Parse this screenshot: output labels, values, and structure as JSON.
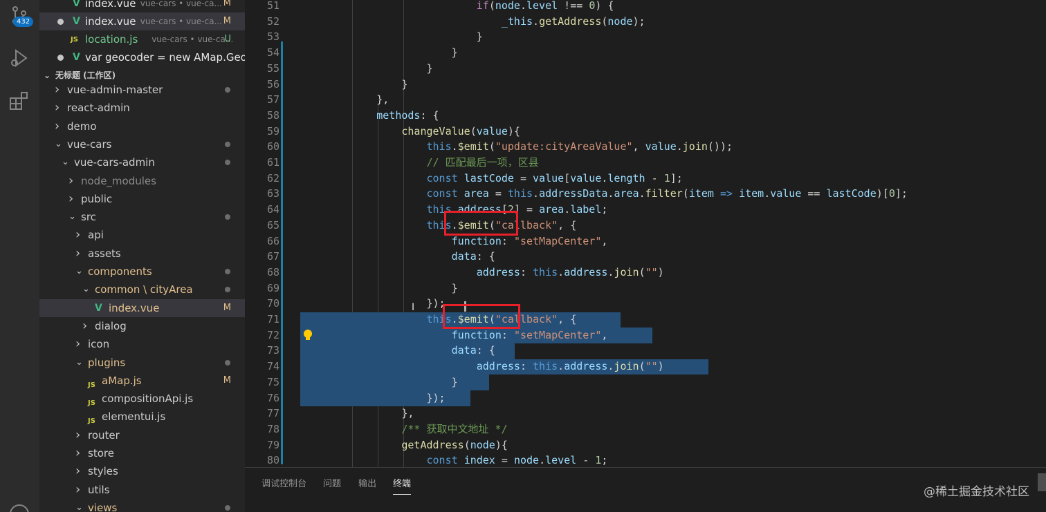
{
  "activity_bar": {
    "scm_badge": "432",
    "icons": [
      "source-control-icon",
      "run-debug-icon",
      "extensions-icon",
      "account-icon"
    ]
  },
  "open_editors": [
    {
      "name": "index.vue",
      "desc": "vue-cars • vue-ca...",
      "status": "M",
      "icon": "vue",
      "active": false
    },
    {
      "name": "index.vue",
      "desc": "vue-cars • vue-ca...",
      "status": "M",
      "icon": "vue",
      "active": true
    },
    {
      "name": "location.js",
      "desc": "vue-cars • vue-ca...",
      "status": "U",
      "icon": "js",
      "active": false
    },
    {
      "name": "var geocoder = new AMap.Geo...",
      "desc": "",
      "status": "",
      "icon": "vue",
      "active": false
    }
  ],
  "workspace": {
    "title": "无标题 (工作区)",
    "tree": [
      {
        "label": "vue-admin-master",
        "depth": 0,
        "chev": ">",
        "dot": true
      },
      {
        "label": "react-admin",
        "depth": 0,
        "chev": ">",
        "dot": false
      },
      {
        "label": "demo",
        "depth": 0,
        "chev": ">",
        "dot": false
      },
      {
        "label": "vue-cars",
        "depth": 0,
        "chev": "v",
        "dot": true
      },
      {
        "label": "vue-cars-admin",
        "depth": 1,
        "chev": "v",
        "dot": true
      },
      {
        "label": "node_modules",
        "depth": 2,
        "chev": ">",
        "dot": false,
        "dim": true
      },
      {
        "label": "public",
        "depth": 2,
        "chev": ">",
        "dot": false
      },
      {
        "label": "src",
        "depth": 2,
        "chev": "v",
        "dot": true
      },
      {
        "label": "api",
        "depth": 3,
        "chev": ">",
        "dot": false
      },
      {
        "label": "assets",
        "depth": 3,
        "chev": ">",
        "dot": false
      },
      {
        "label": "components",
        "depth": 3,
        "chev": "v",
        "dot": true,
        "mod": true
      },
      {
        "label": "common \\ cityArea",
        "depth": 4,
        "chev": "v",
        "dot": true,
        "mod": true
      },
      {
        "label": "index.vue",
        "depth": 5,
        "chev": "",
        "icon": "vue",
        "letter": "M",
        "mod": true,
        "selected": true
      },
      {
        "label": "dialog",
        "depth": 4,
        "chev": ">",
        "dot": false
      },
      {
        "label": "icon",
        "depth": 3,
        "chev": ">",
        "dot": false
      },
      {
        "label": "plugins",
        "depth": 3,
        "chev": "v",
        "dot": true,
        "mod": true
      },
      {
        "label": "aMap.js",
        "depth": 4,
        "chev": "",
        "icon": "js",
        "letter": "M",
        "mod": true
      },
      {
        "label": "compositionApi.js",
        "depth": 4,
        "chev": "",
        "icon": "js"
      },
      {
        "label": "elementui.js",
        "depth": 4,
        "chev": "",
        "icon": "js"
      },
      {
        "label": "router",
        "depth": 3,
        "chev": ">",
        "dot": false
      },
      {
        "label": "store",
        "depth": 3,
        "chev": ">",
        "dot": false
      },
      {
        "label": "styles",
        "depth": 3,
        "chev": ">",
        "dot": false
      },
      {
        "label": "utils",
        "depth": 3,
        "chev": ">",
        "dot": false
      },
      {
        "label": "views",
        "depth": 3,
        "chev": "v",
        "dot": true,
        "mod": true
      }
    ]
  },
  "editor": {
    "lines": [
      {
        "n": "51",
        "tokens": [
          [
            "p",
            "                        "
          ],
          [
            "kc",
            "if"
          ],
          [
            "p",
            "("
          ],
          [
            "v",
            "node"
          ],
          [
            "p",
            "."
          ],
          [
            "v",
            "level"
          ],
          [
            "p",
            " !== "
          ],
          [
            "n",
            "0"
          ],
          [
            "p",
            ") {"
          ]
        ]
      },
      {
        "n": "52",
        "tokens": [
          [
            "p",
            "                            "
          ],
          [
            "v",
            "_this"
          ],
          [
            "p",
            "."
          ],
          [
            "f",
            "getAddress"
          ],
          [
            "p",
            "("
          ],
          [
            "v",
            "node"
          ],
          [
            "p",
            ");"
          ]
        ]
      },
      {
        "n": "53",
        "tokens": [
          [
            "p",
            "                        }"
          ]
        ]
      },
      {
        "n": "54",
        "tokens": [
          [
            "p",
            "                    }"
          ]
        ]
      },
      {
        "n": "55",
        "tokens": [
          [
            "p",
            "                }"
          ]
        ]
      },
      {
        "n": "56",
        "tokens": [
          [
            "p",
            "            }"
          ]
        ]
      },
      {
        "n": "57",
        "tokens": [
          [
            "p",
            "        },"
          ]
        ]
      },
      {
        "n": "58",
        "tokens": [
          [
            "p",
            "        "
          ],
          [
            "v",
            "methods"
          ],
          [
            "p",
            ": {"
          ]
        ]
      },
      {
        "n": "59",
        "tokens": [
          [
            "p",
            "            "
          ],
          [
            "f",
            "changeValue"
          ],
          [
            "p",
            "("
          ],
          [
            "v",
            "value"
          ],
          [
            "p",
            "){"
          ]
        ]
      },
      {
        "n": "60",
        "tokens": [
          [
            "p",
            "                "
          ],
          [
            "k",
            "this"
          ],
          [
            "p",
            "."
          ],
          [
            "f",
            "$emit"
          ],
          [
            "p",
            "("
          ],
          [
            "s",
            "\"update:cityAreaValue\""
          ],
          [
            "p",
            ", "
          ],
          [
            "v",
            "value"
          ],
          [
            "p",
            "."
          ],
          [
            "f",
            "join"
          ],
          [
            "p",
            "());"
          ]
        ]
      },
      {
        "n": "61",
        "tokens": [
          [
            "p",
            "                "
          ],
          [
            "c",
            "// 匹配最后一项，区县"
          ]
        ]
      },
      {
        "n": "62",
        "tokens": [
          [
            "p",
            "                "
          ],
          [
            "k",
            "const"
          ],
          [
            "p",
            " "
          ],
          [
            "v",
            "lastCode"
          ],
          [
            "p",
            " = "
          ],
          [
            "v",
            "value"
          ],
          [
            "p",
            "["
          ],
          [
            "v",
            "value"
          ],
          [
            "p",
            "."
          ],
          [
            "v",
            "length"
          ],
          [
            "p",
            " - "
          ],
          [
            "n",
            "1"
          ],
          [
            "p",
            "];"
          ]
        ]
      },
      {
        "n": "63",
        "tokens": [
          [
            "p",
            "                "
          ],
          [
            "k",
            "const"
          ],
          [
            "p",
            " "
          ],
          [
            "v",
            "area"
          ],
          [
            "p",
            " = "
          ],
          [
            "k",
            "this"
          ],
          [
            "p",
            "."
          ],
          [
            "v",
            "addressData"
          ],
          [
            "p",
            "."
          ],
          [
            "v",
            "area"
          ],
          [
            "p",
            "."
          ],
          [
            "f",
            "filter"
          ],
          [
            "p",
            "("
          ],
          [
            "v",
            "item"
          ],
          [
            "p",
            " "
          ],
          [
            "k",
            "=>"
          ],
          [
            "p",
            " "
          ],
          [
            "v",
            "item"
          ],
          [
            "p",
            "."
          ],
          [
            "v",
            "value"
          ],
          [
            "p",
            " == "
          ],
          [
            "v",
            "lastCode"
          ],
          [
            "p",
            ")["
          ],
          [
            "n",
            "0"
          ],
          [
            "p",
            "];"
          ]
        ]
      },
      {
        "n": "64",
        "tokens": [
          [
            "p",
            "                "
          ],
          [
            "k",
            "this"
          ],
          [
            "p",
            "."
          ],
          [
            "v",
            "address"
          ],
          [
            "p",
            "["
          ],
          [
            "n",
            "2"
          ],
          [
            "p",
            "] = "
          ],
          [
            "v",
            "area"
          ],
          [
            "p",
            "."
          ],
          [
            "v",
            "label"
          ],
          [
            "p",
            ";"
          ]
        ]
      },
      {
        "n": "65",
        "tokens": [
          [
            "p",
            "                "
          ],
          [
            "k",
            "this"
          ],
          [
            "p",
            "."
          ],
          [
            "f",
            "$emit"
          ],
          [
            "p",
            "("
          ],
          [
            "s",
            "\"callback\""
          ],
          [
            "p",
            ", {"
          ]
        ]
      },
      {
        "n": "66",
        "tokens": [
          [
            "p",
            "                    "
          ],
          [
            "v",
            "function"
          ],
          [
            "p",
            ": "
          ],
          [
            "s",
            "\"setMapCenter\""
          ],
          [
            "p",
            ","
          ]
        ]
      },
      {
        "n": "67",
        "tokens": [
          [
            "p",
            "                    "
          ],
          [
            "v",
            "data"
          ],
          [
            "p",
            ": {"
          ]
        ]
      },
      {
        "n": "68",
        "tokens": [
          [
            "p",
            "                        "
          ],
          [
            "v",
            "address"
          ],
          [
            "p",
            ": "
          ],
          [
            "k",
            "this"
          ],
          [
            "p",
            "."
          ],
          [
            "v",
            "address"
          ],
          [
            "p",
            "."
          ],
          [
            "f",
            "join"
          ],
          [
            "p",
            "("
          ],
          [
            "s",
            "\"\""
          ],
          [
            "p",
            ")"
          ]
        ]
      },
      {
        "n": "69",
        "tokens": [
          [
            "p",
            "                    }"
          ]
        ]
      },
      {
        "n": "70",
        "tokens": [
          [
            "p",
            "                });"
          ]
        ]
      },
      {
        "n": "71",
        "tokens": [
          [
            "p",
            "                "
          ],
          [
            "k",
            "this"
          ],
          [
            "p",
            "."
          ],
          [
            "f",
            "$emit"
          ],
          [
            "p",
            "("
          ],
          [
            "s",
            "\"callback\""
          ],
          [
            "p",
            ", {"
          ]
        ]
      },
      {
        "n": "72",
        "tokens": [
          [
            "p",
            "                    "
          ],
          [
            "v",
            "function"
          ],
          [
            "p",
            ": "
          ],
          [
            "s",
            "\"setMapCenter\""
          ],
          [
            "p",
            ","
          ]
        ]
      },
      {
        "n": "73",
        "tokens": [
          [
            "p",
            "                    "
          ],
          [
            "v",
            "data"
          ],
          [
            "p",
            ": {"
          ]
        ]
      },
      {
        "n": "74",
        "tokens": [
          [
            "p",
            "                        "
          ],
          [
            "v",
            "address"
          ],
          [
            "p",
            ": "
          ],
          [
            "k",
            "this"
          ],
          [
            "p",
            "."
          ],
          [
            "v",
            "address"
          ],
          [
            "p",
            "."
          ],
          [
            "f",
            "join"
          ],
          [
            "p",
            "("
          ],
          [
            "s",
            "\"\""
          ],
          [
            "p",
            ")"
          ]
        ]
      },
      {
        "n": "75",
        "tokens": [
          [
            "p",
            "                    }"
          ]
        ]
      },
      {
        "n": "76",
        "tokens": [
          [
            "p",
            "                });"
          ]
        ]
      },
      {
        "n": "77",
        "tokens": [
          [
            "p",
            "            },"
          ]
        ]
      },
      {
        "n": "78",
        "tokens": [
          [
            "p",
            "            "
          ],
          [
            "c",
            "/** 获取中文地址 */"
          ]
        ]
      },
      {
        "n": "79",
        "tokens": [
          [
            "p",
            "            "
          ],
          [
            "f",
            "getAddress"
          ],
          [
            "p",
            "("
          ],
          [
            "v",
            "node"
          ],
          [
            "p",
            "){"
          ]
        ]
      },
      {
        "n": "80",
        "tokens": [
          [
            "p",
            "                "
          ],
          [
            "k",
            "const"
          ],
          [
            "p",
            " "
          ],
          [
            "v",
            "index"
          ],
          [
            "p",
            " = "
          ],
          [
            "v",
            "node"
          ],
          [
            "p",
            "."
          ],
          [
            "v",
            "level"
          ],
          [
            "p",
            " - "
          ],
          [
            "n",
            "1"
          ],
          [
            "p",
            ";"
          ]
        ]
      }
    ]
  },
  "panel": {
    "tabs": [
      "调试控制台",
      "问题",
      "输出",
      "终端"
    ],
    "active_tab": "终端"
  },
  "watermark": "@稀土掘金技术社区"
}
